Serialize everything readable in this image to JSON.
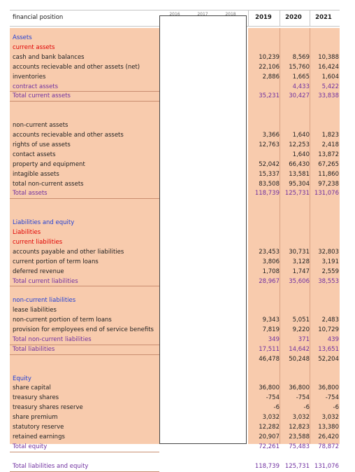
{
  "header": {
    "title": "financial position",
    "hidden_years": [
      "2016",
      "2017",
      "2018"
    ],
    "years": [
      "2019",
      "2020",
      "2021"
    ]
  },
  "rows": [
    {
      "label": "Assets",
      "color": "blue"
    },
    {
      "label": "current assets",
      "color": "red"
    },
    {
      "label": "cash and bank balances",
      "color": "dark",
      "values": [
        "10,239",
        "8,569",
        "10,388"
      ]
    },
    {
      "label": "accounts recievable and other assets (net)",
      "color": "dark",
      "values": [
        "22,106",
        "15,760",
        "16,424"
      ]
    },
    {
      "label": "inventories",
      "color": "dark",
      "values": [
        "2,886",
        "1,665",
        "1,604"
      ]
    },
    {
      "label": "contract assets",
      "color": "purple",
      "values": [
        "",
        "4,433",
        "5,422"
      ]
    },
    {
      "label": "Total current assets",
      "color": "purple",
      "values": [
        "35,231",
        "30,427",
        "33,838"
      ]
    },
    {
      "label": "",
      "color": "dark"
    },
    {
      "label": "",
      "color": "dark"
    },
    {
      "label": "non-current assets",
      "color": "dark"
    },
    {
      "label": "accounts recievable and other assets",
      "color": "dark",
      "values": [
        "3,366",
        "1,640",
        "1,823"
      ]
    },
    {
      "label": "rights of use assets",
      "color": "dark",
      "values": [
        "12,763",
        "12,253",
        "2,418"
      ]
    },
    {
      "label": "contact assets",
      "color": "dark",
      "values": [
        "",
        "1,640",
        "13,872"
      ]
    },
    {
      "label": "property and equipment",
      "color": "dark",
      "values": [
        "52,042",
        "66,430",
        "67,265"
      ]
    },
    {
      "label": "intagible assets",
      "color": "dark",
      "values": [
        "15,337",
        "13,581",
        "11,860"
      ]
    },
    {
      "label": "total non-current assets",
      "color": "dark",
      "values": [
        "83,508",
        "95,304",
        "97,238"
      ]
    },
    {
      "label": "Total assets",
      "color": "purple",
      "values": [
        "118,739",
        "125,731",
        "131,076"
      ]
    },
    {
      "label": "",
      "color": "dark"
    },
    {
      "label": "",
      "color": "dark"
    },
    {
      "label": "Liabilities and equity",
      "color": "blue"
    },
    {
      "label": "Liabilities",
      "color": "red"
    },
    {
      "label": "current liabilities",
      "color": "red"
    },
    {
      "label": "accounts payable and other liabilities",
      "color": "dark",
      "values": [
        "23,453",
        "30,731",
        "32,803"
      ]
    },
    {
      "label": "current portion of term loans",
      "color": "dark",
      "values": [
        "3,806",
        "3,128",
        "3,191"
      ]
    },
    {
      "label": "deferred revenue",
      "color": "dark",
      "values": [
        "1,708",
        "1,747",
        "2,559"
      ]
    },
    {
      "label": "Total current liabilities",
      "color": "purple",
      "values": [
        "28,967",
        "35,606",
        "38,553"
      ]
    },
    {
      "label": "",
      "color": "dark"
    },
    {
      "label": "non-current liabilities",
      "color": "blue"
    },
    {
      "label": "lease liabilities",
      "color": "dark"
    },
    {
      "label": "non-current portion of term loans",
      "color": "dark",
      "values": [
        "9,343",
        "5,051",
        "2,483"
      ]
    },
    {
      "label": "provision for employees end of service benefits",
      "color": "dark",
      "values": [
        "7,819",
        "9,220",
        "10,729"
      ]
    },
    {
      "label": "Total non-current liabilities",
      "color": "purple",
      "values": [
        "349",
        "371",
        "439"
      ]
    },
    {
      "label": "Total liabilities",
      "color": "purple",
      "values": [
        "17,511",
        "14,642",
        "13,651"
      ]
    },
    {
      "label": "",
      "color": "dark",
      "values": [
        "46,478",
        "50,248",
        "52,204"
      ]
    },
    {
      "label": "",
      "color": "dark"
    },
    {
      "label": "Equity",
      "color": "blue"
    },
    {
      "label": "share capital",
      "color": "dark",
      "values": [
        "36,800",
        "36,800",
        "36,800"
      ]
    },
    {
      "label": "treasury shares",
      "color": "dark",
      "values": [
        "-754",
        "-754",
        "-754"
      ]
    },
    {
      "label": "treasury shares reserve",
      "color": "dark",
      "values": [
        "-6",
        "-6",
        "-6"
      ]
    },
    {
      "label": "share premium",
      "color": "dark",
      "values": [
        "3,032",
        "3,032",
        "3,032"
      ]
    },
    {
      "label": "statutory reserve",
      "color": "dark",
      "values": [
        "12,282",
        "12,823",
        "13,380"
      ]
    },
    {
      "label": "retained earnings",
      "color": "dark",
      "values": [
        "20,907",
        "23,588",
        "26,420"
      ]
    },
    {
      "label": "Total equity",
      "color": "purple",
      "values": [
        "72,261",
        "75,483",
        "78,872"
      ]
    },
    {
      "label": "",
      "color": "dark"
    },
    {
      "label": "Total liabilities and equity",
      "color": "purple",
      "values": [
        "118,739",
        "125,731",
        "131,076"
      ]
    }
  ]
}
